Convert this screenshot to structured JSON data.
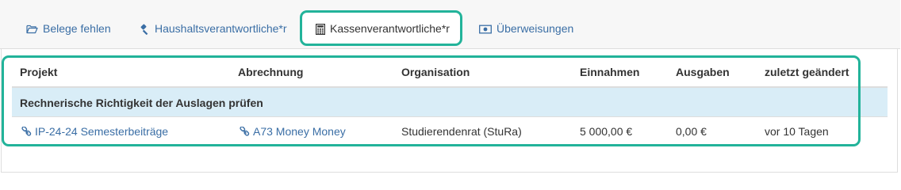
{
  "tabs": [
    {
      "label": "Belege fehlen",
      "icon": "folder-open-icon"
    },
    {
      "label": "Haushaltsverantwortliche*r",
      "icon": "gavel-icon"
    },
    {
      "label": "Kassenverantwortliche*r",
      "icon": "calculator-icon",
      "active": true
    },
    {
      "label": "Überweisungen",
      "icon": "money-icon"
    }
  ],
  "table": {
    "headers": [
      "Projekt",
      "Abrechnung",
      "Organisation",
      "Einnahmen",
      "Ausgaben",
      "zuletzt geändert"
    ],
    "group_label": "Rechnerische Richtigkeit der Auslagen prüfen",
    "rows": [
      {
        "projekt": "IP-24-24 Semesterbeiträge",
        "abrechnung": "A73 Money Money",
        "organisation": "Studierendenrat (StuRa)",
        "einnahmen": "5 000,00 €",
        "ausgaben": "0,00 €",
        "geaendert": "vor 10 Tagen"
      }
    ]
  },
  "colors": {
    "link": "#3a6ea5",
    "highlight": "#22b39a",
    "group_row": "#d9edf7"
  }
}
